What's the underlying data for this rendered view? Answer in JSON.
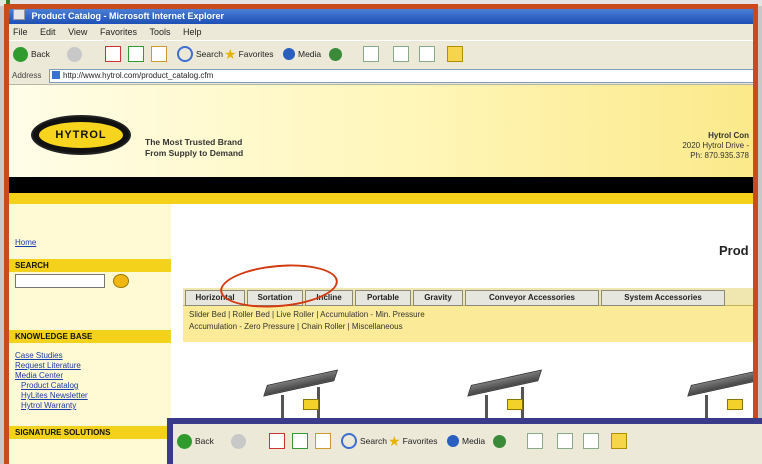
{
  "window": {
    "title": "Product Catalog - Microsoft Internet Explorer"
  },
  "menu": [
    "File",
    "Edit",
    "View",
    "Favorites",
    "Tools",
    "Help"
  ],
  "toolbar": {
    "back": "Back",
    "search": "Search",
    "favorites": "Favorites",
    "media": "Media"
  },
  "address": {
    "label": "Address",
    "url": "http://www.hytrol.com/product_catalog.cfm"
  },
  "site": {
    "logo_text": "HYTROL",
    "tagline": [
      "The Most Trusted Brand",
      "From Supply to Demand"
    ],
    "contact": [
      "Hytrol Con",
      "2020 Hytrol Drive -",
      "Ph: 870.935.378"
    ]
  },
  "sidebar": {
    "home": "Home",
    "search_heading": "SEARCH",
    "kb_heading": "KNOWLEDGE BASE",
    "kb_links": [
      "Case Studies",
      "Request Literature",
      "Media Center",
      "Product Catalog",
      "HyLites Newsletter",
      "Hytrol Warranty"
    ],
    "solutions_heading": "SIGNATURE SOLUTIONS"
  },
  "main": {
    "title": "Prod",
    "tabs": [
      "Horizontal",
      "Sortation",
      "Incline",
      "Portable",
      "Gravity",
      "Conveyor Accessories",
      "System Accessories"
    ],
    "subnav_line1": "Slider Bed  |  Roller Bed  |  Live Roller  |  Accumulation - Min. Pressure",
    "subnav_line2": "Accumulation - Zero Pressure  |  Chain Roller  |  Miscellaneous"
  },
  "colors": {
    "frame": "#c94a1c",
    "accent": "#f4d21c",
    "annotation": "#d33a10",
    "overlay": "#3a3a8a"
  },
  "icons": [
    "back-icon",
    "forward-icon",
    "stop-icon",
    "refresh-icon",
    "home-icon",
    "search-icon",
    "favorites-icon",
    "media-icon",
    "history-icon",
    "mail-icon",
    "print-icon",
    "edit-icon",
    "folder-icon"
  ]
}
